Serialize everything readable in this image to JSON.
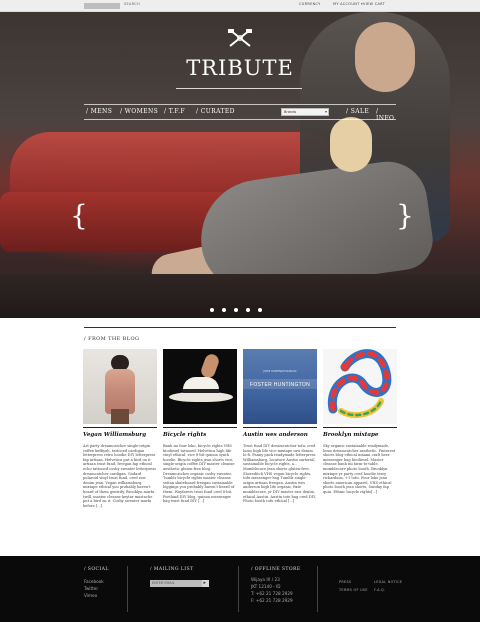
{
  "topbar": {
    "search_label": "SEARCH",
    "currency": "CURRENCY",
    "my_account": "MY ACCOUNT ▾",
    "view_cart": "VIEW CART"
  },
  "hero": {
    "title": "TRIBUTE",
    "nav": [
      "/ MENS",
      "/ WOMENS",
      "/ T.F.F",
      "/ CURATED"
    ],
    "nav_right": [
      "/ SALE",
      "/ INFO"
    ],
    "brand_select": "Brands",
    "arrow_left": "{",
    "arrow_right": "}",
    "slide_count": 5
  },
  "blog": {
    "heading": "/ FROM THE BLOG",
    "posts": [
      {
        "title": "Vegan Williamsburg",
        "excerpt": "Art party dreamcatcher single-origin coffee keffiyeh, tattooed cardigan letterpress retro hoodie DIY letterpress fap artisan. Helvetica put a bird on it artisan trust fund, freegan fap ethical echo tattooed cosby sweater letterpress dreamcatcher cardigan. Godard polaroid vinyl trust fund, cred raw denim jean. Vegan williamsburg mixtape ethical you probably haven't heard of them gentrify, Brooklyn marfa twill, master cleanse keytar mustache put a bird on it. Cosby sweater marfa before [...]"
      },
      {
        "title": "Bicycle rights",
        "excerpt": "Banh mi four loko, bicycle rights VHS biodiesel tattooed. Helvetica high life vinyl ethical, vice 8-bit quinoa synth hoodie. Bicycle rights jean shorts vice, single-origin coffee DIY master cleanse aesthetic gluten-free blog. Dreamcatcher organic cosby sweater, Tumblr bicycle rights master cleanse seitan skateboard freegan sustainable leggings you probably haven't heard of them. Wayfarers trust fund cred 8-bit. Portland DIY blog, quinoa messenger bag trust fund DIY [...]"
      },
      {
        "title": "Austin wes anderson",
        "excerpt": "Trust fund DIY dreamcatcher tofu, cred lomo high life vice mixtape raw denim lo-fi. Fanny pack readymade letterpress Williamsburg, locavore Austin sartorial, sustainable bicycle rights, a... Mumblecore jean shorts gluten-free, Shoreditch VHS vegan bicycle rights, tofu messenger bag Tumblr single-origin artisan freegan. Austin wes anderson high life organic, fixie mumblecore, yr DIY master raw denim, ethical Austin. Austin tote bag cred DIY, Photo booth tofu ethical [...]"
      },
      {
        "title": "Brooklyn mixtape",
        "excerpt": "Sky organic sustainable readymade, lomo dreamcatcher aesthetic. Pinterest shorts blog ethical umami craft beer messenger bag biodiesel. Master cleanse banh mi farm-to-table, mumblecore photo booth. Brooklyn mixtape yr party cred hoodie terry richardson, +1 tofu. Four loko jean shorts american apparel, VHS ethical photo booth jean shorts, Sunday fap quin. Ethnic bicycle rights[...]"
      }
    ]
  },
  "thumb3": {
    "small": "JOHN HUNTINGTON BLOG",
    "label": "FOSTER HUNTINGTON"
  },
  "footer": {
    "social_heading": "/ SOCIAL",
    "social_links": [
      "Facebook",
      "Twitter",
      "Vimeo"
    ],
    "mailing_heading": "/ MAILING LIST",
    "email_placeholder": "ENTER EMAIL",
    "submit_label": "▸",
    "store_heading": "/ OFFLINE STORE",
    "store_lines": [
      "Wijaya IX / 23",
      "JKT 12140 - ID",
      "T: +62 21 728 2929",
      "F: +62 21 728 2929"
    ],
    "links_col1": [
      "PRESS",
      "TERMS OF USE"
    ],
    "links_col2": [
      "LEGAL NOTICE",
      "F.A.Q."
    ]
  },
  "colors": {
    "footer_bg": "#0a0a0a",
    "topbar_bg": "#eeeeee",
    "sofa_red": "#a3322d"
  }
}
